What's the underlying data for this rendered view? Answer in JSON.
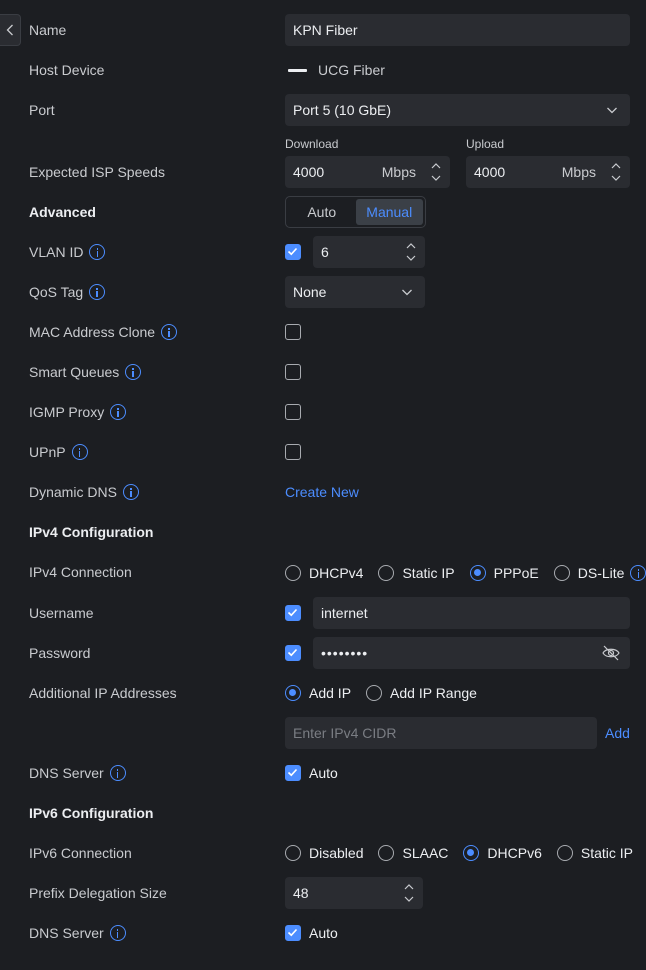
{
  "name": {
    "label": "Name",
    "value": "KPN Fiber"
  },
  "host_device": {
    "label": "Host Device",
    "value": "UCG Fiber"
  },
  "port": {
    "label": "Port",
    "value": "Port 5 (10 GbE)"
  },
  "isp_speeds": {
    "label": "Expected ISP Speeds",
    "download_label": "Download",
    "download_value": "4000",
    "download_unit": "Mbps",
    "upload_label": "Upload",
    "upload_value": "4000",
    "upload_unit": "Mbps"
  },
  "advanced": {
    "label": "Advanced",
    "options": [
      "Auto",
      "Manual"
    ],
    "selected": "Manual"
  },
  "vlan": {
    "label": "VLAN ID",
    "checked": true,
    "value": "6"
  },
  "qos": {
    "label": "QoS Tag",
    "value": "None"
  },
  "mac_clone": {
    "label": "MAC Address Clone",
    "checked": false
  },
  "smart_queues": {
    "label": "Smart Queues",
    "checked": false
  },
  "igmp_proxy": {
    "label": "IGMP Proxy",
    "checked": false
  },
  "upnp": {
    "label": "UPnP",
    "checked": false
  },
  "dynamic_dns": {
    "label": "Dynamic DNS",
    "link": "Create New"
  },
  "ipv4": {
    "section": "IPv4 Configuration",
    "connection_label": "IPv4 Connection",
    "connection_options": [
      "DHCPv4",
      "Static IP",
      "PPPoE",
      "DS-Lite"
    ],
    "connection_selected": "PPPoE",
    "username_label": "Username",
    "username": "internet",
    "password_label": "Password",
    "password": "••••••••",
    "additional_label": "Additional IP Addresses",
    "additional_options": [
      "Add IP",
      "Add IP Range"
    ],
    "additional_selected": "Add IP",
    "cidr_placeholder": "Enter IPv4 CIDR",
    "add_link": "Add",
    "dns_label": "DNS Server",
    "dns_auto": "Auto"
  },
  "ipv6": {
    "section": "IPv6 Configuration",
    "connection_label": "IPv6 Connection",
    "connection_options": [
      "Disabled",
      "SLAAC",
      "DHCPv6",
      "Static IP"
    ],
    "connection_selected": "DHCPv6",
    "prefix_label": "Prefix Delegation Size",
    "prefix_value": "48",
    "dns_label": "DNS Server",
    "dns_auto": "Auto"
  },
  "colors": {
    "accent": "#4c8dff",
    "background": "#1c1e22",
    "field": "#2a2c31"
  }
}
